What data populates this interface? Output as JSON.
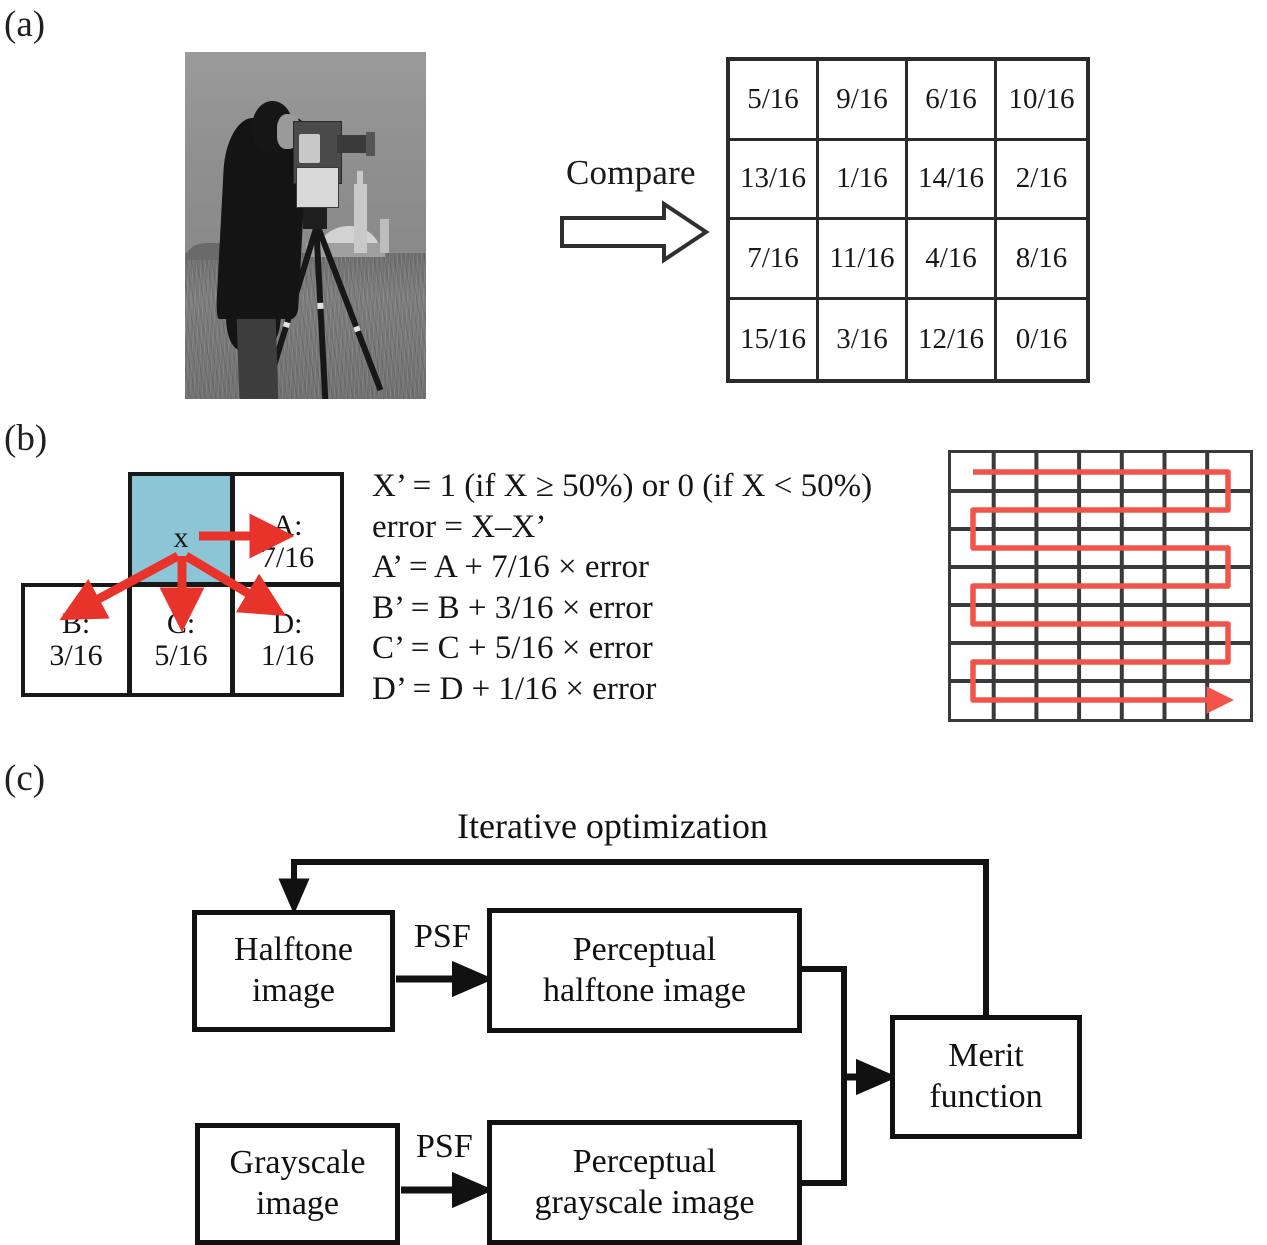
{
  "panels": {
    "a": {
      "label": "(a)"
    },
    "b": {
      "label": "(b)"
    },
    "c": {
      "label": "(c)"
    }
  },
  "panel_a": {
    "photo_alt": "cameraman-grayscale-test-image",
    "compare_label": "Compare",
    "bayer_matrix": {
      "rows": [
        [
          "5/16",
          "9/16",
          "6/16",
          "10/16"
        ],
        [
          "13/16",
          "1/16",
          "14/16",
          "2/16"
        ],
        [
          "7/16",
          "11/16",
          "4/16",
          "8/16"
        ],
        [
          "15/16",
          "3/16",
          "12/16",
          "0/16"
        ]
      ]
    }
  },
  "panel_b": {
    "diffusion_cells": {
      "x": {
        "label": "x"
      },
      "a": {
        "label": "A:",
        "weight": "7/16"
      },
      "b": {
        "label": "B:",
        "weight": "3/16"
      },
      "c": {
        "label": "C:",
        "weight": "5/16"
      },
      "d": {
        "label": "D:",
        "weight": "1/16"
      }
    },
    "highlight_color": "#8cc6d6",
    "arrow_color": "#e8332a",
    "equations": [
      "X’ = 1 (if X ≥ 50%) or 0 (if X < 50%)",
      "error = X–X’",
      "A’ = A + 7/16 × error",
      "B’ = B + 3/16 × error",
      "C’ = C + 5/16 × error",
      "D’ = D + 1/16 × error"
    ],
    "serpentine": {
      "columns": 7,
      "rows": 7,
      "path_color": "#f2534a",
      "grid_color": "#3a3a3a"
    }
  },
  "panel_c": {
    "title": "Iterative optimization",
    "boxes": {
      "halftone": "Halftone\nimage",
      "perceptual_halftone": "Perceptual\nhalftone image",
      "merit": "Merit\nfunction",
      "grayscale": "Grayscale\nimage",
      "perceptual_grayscale": "Perceptual\ngrayscale image"
    },
    "edge_labels": {
      "psf_top": "PSF",
      "psf_bottom": "PSF"
    }
  }
}
